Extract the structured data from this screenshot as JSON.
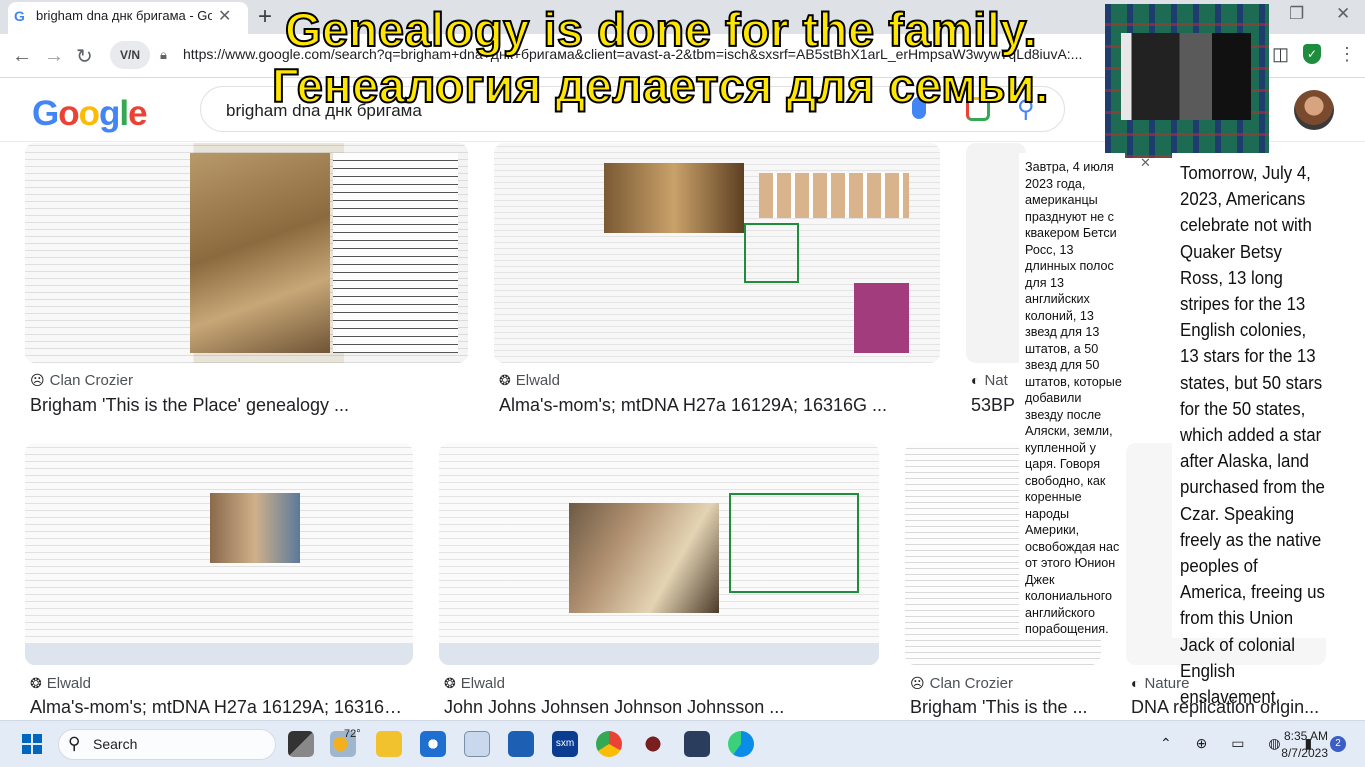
{
  "browser": {
    "tab_title": "brigham dna днк бригама - Goo",
    "url": "https://www.google.com/search?q=brigham+dna+днк+бригама&client=avast-a-2&tbm=isch&sxsrf=AB5stBhX1arL_erHmpsaW3wyw7qLd8iuvA:...",
    "vpn_label": "V/N",
    "tab_close": "✕",
    "new_tab": "+",
    "win_min": "—",
    "win_max": "❐",
    "win_close": "✕"
  },
  "google": {
    "query": "brigham dna днк бригама"
  },
  "results": [
    {
      "source": "Clan Crozier",
      "source_glyph": "☹",
      "title": "Brigham 'This is the Place' genealogy ..."
    },
    {
      "source": "Elwald",
      "source_glyph": "❂",
      "title": "Alma's-mom's; mtDNA H27a 16129A; 16316G ..."
    },
    {
      "source": "Nat",
      "source_glyph": "◐",
      "title": "53BP"
    },
    {
      "source": "Elwald",
      "source_glyph": "❂",
      "title": "Alma's-mom's; mtDNA H27a 16129A; 16316G ..."
    },
    {
      "source": "Elwald",
      "source_glyph": "❂",
      "title": "John Johns Johnsen Johnson Johnsson ..."
    },
    {
      "source": "Clan Crozier",
      "source_glyph": "☹",
      "title": "Brigham 'This is the ..."
    },
    {
      "source": "Nature",
      "source_glyph": "◐",
      "title": "DNA replication origin..."
    }
  ],
  "overlay": {
    "headline_en": "Genealogy is done for the family.",
    "headline_ru": "Генеалогия делается для семьи.",
    "note_ru": "Завтра, 4 июля 2023 года, американцы празднуют не с квакером Бетси Росс, 13 длинных полос для 13 английских колоний, 13 звезд для 13 штатов, а 50 звезд для 50 штатов, которые добавили звезду после Аляски, земли, купленной у царя. Говоря свободно, как коренные народы Америки, освобождая нас от этого Юнион Джек колониального английского порабощения.",
    "note_en": "Tomorrow, July 4, 2023, Americans celebrate not with Quaker Betsy Ross, 13 long stripes for the 13 English colonies, 13 stars for the 13 states, but 50 stars for the 50 states, which added a star after Alaska, land purchased from the Czar. Speaking freely as the native peoples of America, freeing us from this Union Jack of colonial English enslavement.",
    "note_close": "✕"
  },
  "taskbar": {
    "search_label": "Search",
    "weather": "72°",
    "time": "8:35 AM",
    "date": "8/7/2023",
    "notifications": "2"
  },
  "colors": {
    "google_blue": "#4285f4",
    "google_red": "#ea4335",
    "google_yellow": "#fbbc05",
    "google_green": "#34a853",
    "headline_yellow": "#ffe600"
  }
}
